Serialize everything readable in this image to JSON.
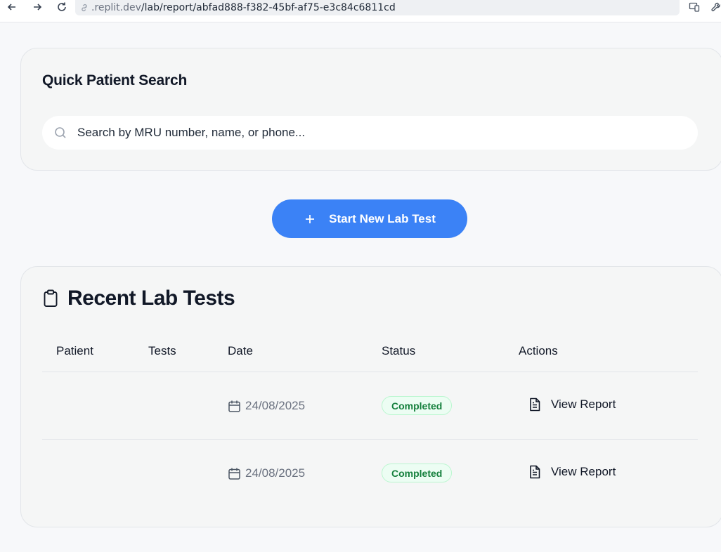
{
  "browser": {
    "url_host": ".replit.dev",
    "url_path": "/lab/report/abfad888-f382-45bf-af75-e3c84c6811cd"
  },
  "search": {
    "title": "Quick Patient Search",
    "placeholder": "Search by MRU number, name, or phone..."
  },
  "cta": {
    "label": "Start New Lab Test"
  },
  "recent": {
    "title": "Recent Lab Tests",
    "columns": [
      "Patient",
      "Tests",
      "Date",
      "Status",
      "Actions"
    ],
    "rows": [
      {
        "patient": "",
        "tests": "",
        "date": "24/08/2025",
        "status": "Completed",
        "action": "View Report"
      },
      {
        "patient": "",
        "tests": "",
        "date": "24/08/2025",
        "status": "Completed",
        "action": "View Report"
      }
    ]
  },
  "colors": {
    "accent": "#3b82f6",
    "status_completed_bg": "#ecfdf3",
    "status_completed_text": "#15803d"
  },
  "icons": {
    "back": "arrow-left-icon",
    "forward": "arrow-right-icon",
    "reload": "reload-icon",
    "link": "link-icon",
    "device": "device-icon",
    "tools": "wrench-icon",
    "search": "search-icon",
    "plus": "plus-icon",
    "clipboard": "clipboard-icon",
    "calendar": "calendar-icon",
    "report": "file-text-icon"
  }
}
